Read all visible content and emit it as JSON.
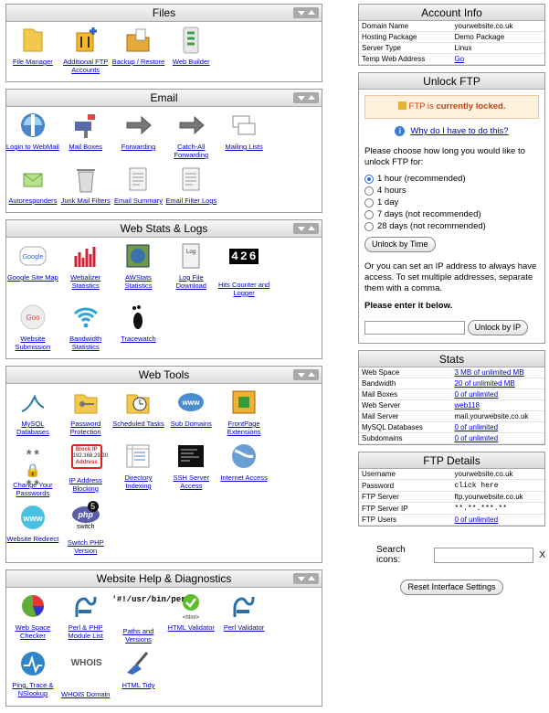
{
  "files": {
    "title": "Files",
    "items": [
      {
        "label": "File Manager",
        "icon": "folder-icon"
      },
      {
        "label": "Additional FTP Accounts",
        "icon": "ftp-accounts-icon"
      },
      {
        "label": "Backup / Restore",
        "icon": "backup-icon"
      },
      {
        "label": "Web Builder",
        "icon": "web-builder-icon"
      }
    ]
  },
  "email": {
    "title": "Email",
    "items": [
      {
        "label": "Login to WebMail",
        "icon": "webmail-icon"
      },
      {
        "label": "Mail Boxes",
        "icon": "mailbox-icon"
      },
      {
        "label": "Forwarding",
        "icon": "forwarding-icon"
      },
      {
        "label": "Catch-All Forwarding",
        "icon": "catch-all-icon"
      },
      {
        "label": "Mailing Lists",
        "icon": "mailing-list-icon"
      },
      {
        "label": "Autoresponders",
        "icon": "autoresponder-icon"
      },
      {
        "label": "Junk Mail Filters",
        "icon": "trash-icon"
      },
      {
        "label": "Email Summary",
        "icon": "summary-icon"
      },
      {
        "label": "Email Filter Logs",
        "icon": "filter-logs-icon"
      }
    ]
  },
  "webstats": {
    "title": "Web Stats & Logs",
    "items": [
      {
        "label": "Google Site Map",
        "icon": "google-icon"
      },
      {
        "label": "Webalizer Statistics",
        "icon": "bar-chart-icon"
      },
      {
        "label": "AWStats Statistics",
        "icon": "awstats-icon"
      },
      {
        "label": "Log File Download",
        "icon": "log-file-icon"
      },
      {
        "label": "Hits Counter and Logger",
        "icon": "counter-icon",
        "counter": "426"
      },
      {
        "label": "Website Submission",
        "icon": "google-submit-icon"
      },
      {
        "label": "Bandwidth Statistics",
        "icon": "wifi-icon"
      },
      {
        "label": "Tracewatch",
        "icon": "footprint-icon"
      }
    ]
  },
  "webtools": {
    "title": "Web Tools",
    "items": [
      {
        "label": "MySQL Databases",
        "icon": "mysql-icon"
      },
      {
        "label": "Password Protection",
        "icon": "key-folder-icon"
      },
      {
        "label": "Scheduled Tasks",
        "icon": "clock-icon"
      },
      {
        "label": "Sub Domains",
        "icon": "www-icon"
      },
      {
        "label": "FrontPage Extensions",
        "icon": "frontpage-icon"
      },
      {
        "label": "Change Your Passwords",
        "icon": "padlock-icon",
        "mask": "**"
      },
      {
        "label": "IP Address Blocking",
        "icon": "block-ip-icon",
        "sign_title": "Block IP",
        "sign_ip": "192.168.29.30",
        "sign_word": "Address"
      },
      {
        "label": "Directory Indexing",
        "icon": "directory-icon"
      },
      {
        "label": "SSH Server Access",
        "icon": "terminal-icon"
      },
      {
        "label": "Internet Access",
        "icon": "internet-icon"
      },
      {
        "label": "Website Redirect",
        "icon": "redirect-icon"
      },
      {
        "label": "Switch PHP Version",
        "icon": "php-switch-icon",
        "badge": "5",
        "word": "switch"
      }
    ]
  },
  "help": {
    "title": "Website Help & Diagnostics",
    "items": [
      {
        "label": "Web Space Checker",
        "icon": "pie-chart-icon"
      },
      {
        "label": "Perl & PHP Module List",
        "icon": "camel-icon"
      },
      {
        "label": "Paths and Versions",
        "icon": "perl-path-icon",
        "text": "'#!/usr/bin/perl'"
      },
      {
        "label": "HTML Validator",
        "icon": "html-check-icon",
        "tag": "<html>"
      },
      {
        "label": "Perl Validator",
        "icon": "camel-icon"
      },
      {
        "label": "Ping, Trace & NSlookup",
        "icon": "ping-icon"
      },
      {
        "label": "WHOIS Domain",
        "icon": "whois-icon",
        "text": "WHOIS"
      },
      {
        "label": "HTML Tidy",
        "icon": "broom-icon"
      }
    ]
  },
  "account": {
    "title": "Account Info",
    "rows": [
      {
        "key": "Domain Name",
        "value": "yourwebsite.co.uk",
        "link": false
      },
      {
        "key": "Hosting Package",
        "value": "Demo Package",
        "link": false
      },
      {
        "key": "Server Type",
        "value": "Linux",
        "link": false
      },
      {
        "key": "Temp Web Address",
        "value": "Go",
        "link": true
      }
    ]
  },
  "unlock": {
    "title": "Unlock FTP",
    "status_prefix": "FTP is ",
    "status_bold": "currently locked.",
    "why": "Why do I have to do this?",
    "prompt": "Please choose how long you would like to unlock FTP for:",
    "options": [
      "1 hour (recommended)",
      "4 hours",
      "1 day",
      "7 days (not recommended)",
      "28 days (not recommended)"
    ],
    "selected": 0,
    "unlock_time_btn": "Unlock by Time",
    "ip_text": "Or you can set an IP address to always have access. To set multiple addresses, separate them with a comma.",
    "enter_label": "Please enter it below.",
    "ip_value": "",
    "unlock_ip_btn": "Unlock by IP"
  },
  "stats": {
    "title": "Stats",
    "rows": [
      {
        "key": "Web Space",
        "value": "3 MB of unlimited MB",
        "link": true
      },
      {
        "key": "Bandwidth",
        "value": "20 of unlimited MB",
        "link": true
      },
      {
        "key": "Mail Boxes",
        "value": "0 of unlimited",
        "link": true
      },
      {
        "key": "Web Server",
        "value": "web118",
        "link": true
      },
      {
        "key": "Mail Server",
        "value": "mail.yourwebsite.co.uk",
        "link": false
      },
      {
        "key": "MySQL Databases",
        "value": "0 of unlimited",
        "link": true
      },
      {
        "key": "Subdomains",
        "value": "0 of unlimited",
        "link": true
      }
    ]
  },
  "ftp": {
    "title": "FTP Details",
    "rows": [
      {
        "key": "Username",
        "value": "yourwebsite.co.uk",
        "link": false,
        "mono": false
      },
      {
        "key": "Password",
        "value": "click here",
        "link": false,
        "mono": true
      },
      {
        "key": "FTP Server",
        "value": "ftp.yourwebsite.co.uk",
        "link": false,
        "mono": false
      },
      {
        "key": "FTP Server IP",
        "value": "**.**.***.**",
        "link": false,
        "mono": true
      },
      {
        "key": "FTP Users",
        "value": "0 of unlimited",
        "link": true,
        "mono": false
      }
    ]
  },
  "search": {
    "label": "Search icons:",
    "value": "",
    "clear": "X"
  },
  "reset_btn": "Reset Interface Settings"
}
